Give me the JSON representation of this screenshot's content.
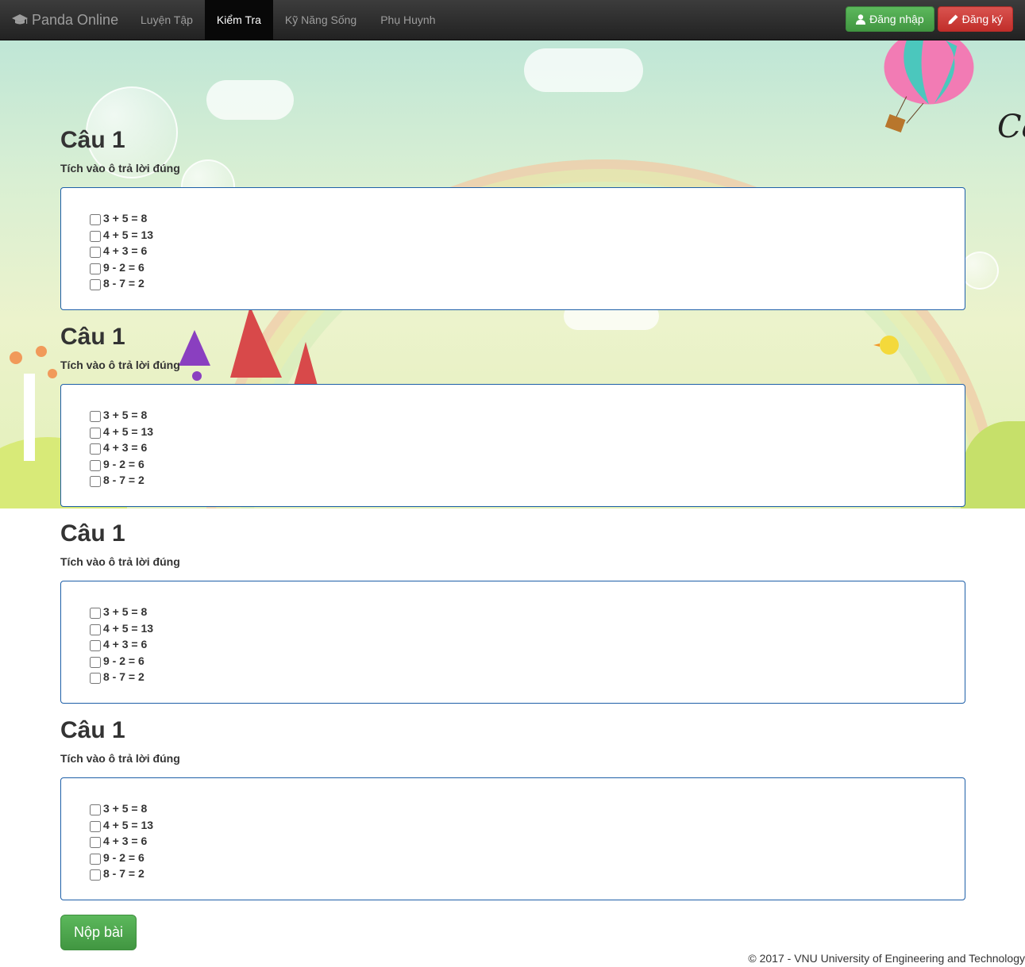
{
  "nav": {
    "brand": "Panda Online",
    "items": [
      {
        "label": "Luyện Tập",
        "active": false
      },
      {
        "label": "Kiểm Tra",
        "active": true
      },
      {
        "label": "Kỹ Năng Sống",
        "active": false
      },
      {
        "label": "Phụ Huynh",
        "active": false
      }
    ],
    "login": "Đăng nhập",
    "register": "Đăng ký"
  },
  "banner": {
    "title_fragment": "Ca"
  },
  "questions": [
    {
      "title": "Câu 1",
      "instruction": "Tích vào ô trả lời đúng",
      "options": [
        "3 + 5 = 8",
        "4 + 5 = 13",
        "4 + 3 = 6",
        "9 - 2 = 6",
        "8 - 7 = 2"
      ]
    },
    {
      "title": "Câu 1",
      "instruction": "Tích vào ô trả lời đúng",
      "options": [
        "3 + 5 = 8",
        "4 + 5 = 13",
        "4 + 3 = 6",
        "9 - 2 = 6",
        "8 - 7 = 2"
      ]
    },
    {
      "title": "Câu 1",
      "instruction": "Tích vào ô trả lời đúng",
      "options": [
        "3 + 5 = 8",
        "4 + 5 = 13",
        "4 + 3 = 6",
        "9 - 2 = 6",
        "8 - 7 = 2"
      ]
    },
    {
      "title": "Câu 1",
      "instruction": "Tích vào ô trả lời đúng",
      "options": [
        "3 + 5 = 8",
        "4 + 5 = 13",
        "4 + 3 = 6",
        "9 - 2 = 6",
        "8 - 7 = 2"
      ]
    }
  ],
  "submit_label": "Nộp bài",
  "footer": "© 2017 - VNU University of Engineering and Technology",
  "colors": {
    "navbar": "#222222",
    "success": "#5cb85c",
    "danger": "#d9534f",
    "box_border": "#1e5fa8"
  }
}
